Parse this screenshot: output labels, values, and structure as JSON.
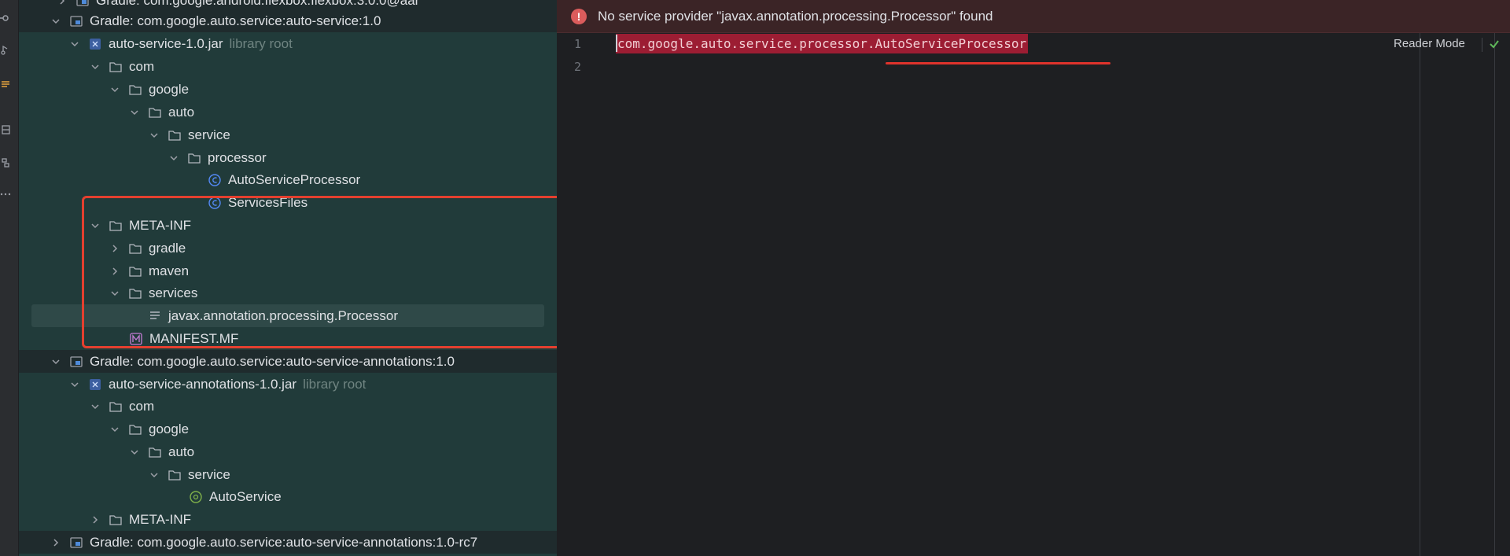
{
  "tree": {
    "rows": [
      {
        "label": "Gradle: com.google.android.flexbox:flexbox:3.0.0@aar",
        "hint": ""
      },
      {
        "label": "Gradle: com.google.auto.service:auto-service:1.0",
        "hint": ""
      },
      {
        "label": "auto-service-1.0.jar",
        "hint": "library root"
      },
      {
        "label": "com",
        "hint": ""
      },
      {
        "label": "google",
        "hint": ""
      },
      {
        "label": "auto",
        "hint": ""
      },
      {
        "label": "service",
        "hint": ""
      },
      {
        "label": "processor",
        "hint": ""
      },
      {
        "label": "AutoServiceProcessor",
        "hint": ""
      },
      {
        "label": "ServicesFiles",
        "hint": ""
      },
      {
        "label": "META-INF",
        "hint": ""
      },
      {
        "label": "gradle",
        "hint": ""
      },
      {
        "label": "maven",
        "hint": ""
      },
      {
        "label": "services",
        "hint": ""
      },
      {
        "label": "javax.annotation.processing.Processor",
        "hint": ""
      },
      {
        "label": "MANIFEST.MF",
        "hint": ""
      },
      {
        "label": "Gradle: com.google.auto.service:auto-service-annotations:1.0",
        "hint": ""
      },
      {
        "label": "auto-service-annotations-1.0.jar",
        "hint": "library root"
      },
      {
        "label": "com",
        "hint": ""
      },
      {
        "label": "google",
        "hint": ""
      },
      {
        "label": "auto",
        "hint": ""
      },
      {
        "label": "service",
        "hint": ""
      },
      {
        "label": "AutoService",
        "hint": ""
      },
      {
        "label": "META-INF",
        "hint": ""
      },
      {
        "label": "Gradle: com.google.auto.service:auto-service-annotations:1.0-rc7",
        "hint": ""
      }
    ]
  },
  "editor": {
    "banner": "No service provider \"javax.annotation.processing.Processor\" found",
    "banner_icon": "!",
    "line_numbers": [
      "1",
      "2"
    ],
    "code_line_1": "com.google.auto.service.processor.AutoServiceProcessor",
    "reader_mode": "Reader Mode"
  },
  "colors": {
    "tree_bg": "#213b3a",
    "highlight": "#e4402f",
    "code_highlight": "#9c1d33",
    "accent": "#6f73e3"
  }
}
